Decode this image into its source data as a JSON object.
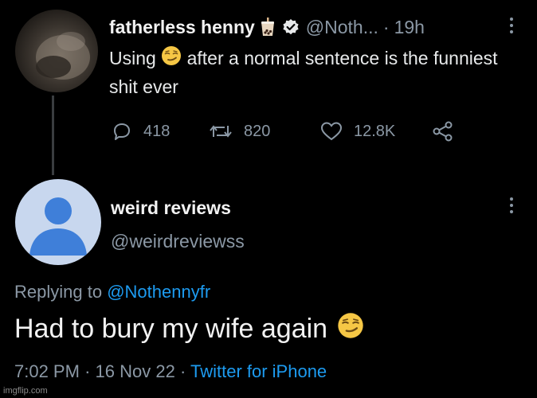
{
  "original_tweet": {
    "display_name": "fatherless henny",
    "handle": "@Noth...",
    "separator": "·",
    "time_ago": "19h",
    "text_before_emoji": "Using",
    "text_after_emoji": "after a normal sentence is the funniest shit ever",
    "emoji_icon": "smirking-face",
    "badges": [
      "bubble-tea-icon",
      "verified-badge-icon"
    ],
    "replies": "418",
    "retweets": "820",
    "likes": "12.8K"
  },
  "reply_tweet": {
    "display_name": "weird reviews",
    "handle": "@weirdreviewss",
    "replying_prefix": "Replying to",
    "replying_mention": "@Nothennyfr",
    "text": "Had to bury my wife again",
    "emoji_icon": "smirking-face",
    "time": "7:02 PM",
    "date": "16 Nov 22",
    "separator": "·",
    "source": "Twitter for iPhone"
  },
  "watermark": "imgflip.com",
  "colors": {
    "background": "#000000",
    "text": "#e7e9ea",
    "muted": "#8b98a5",
    "link": "#1d9bf0",
    "default_avatar_bg": "#c8d7ee",
    "default_avatar_fg": "#3f7fd9"
  }
}
